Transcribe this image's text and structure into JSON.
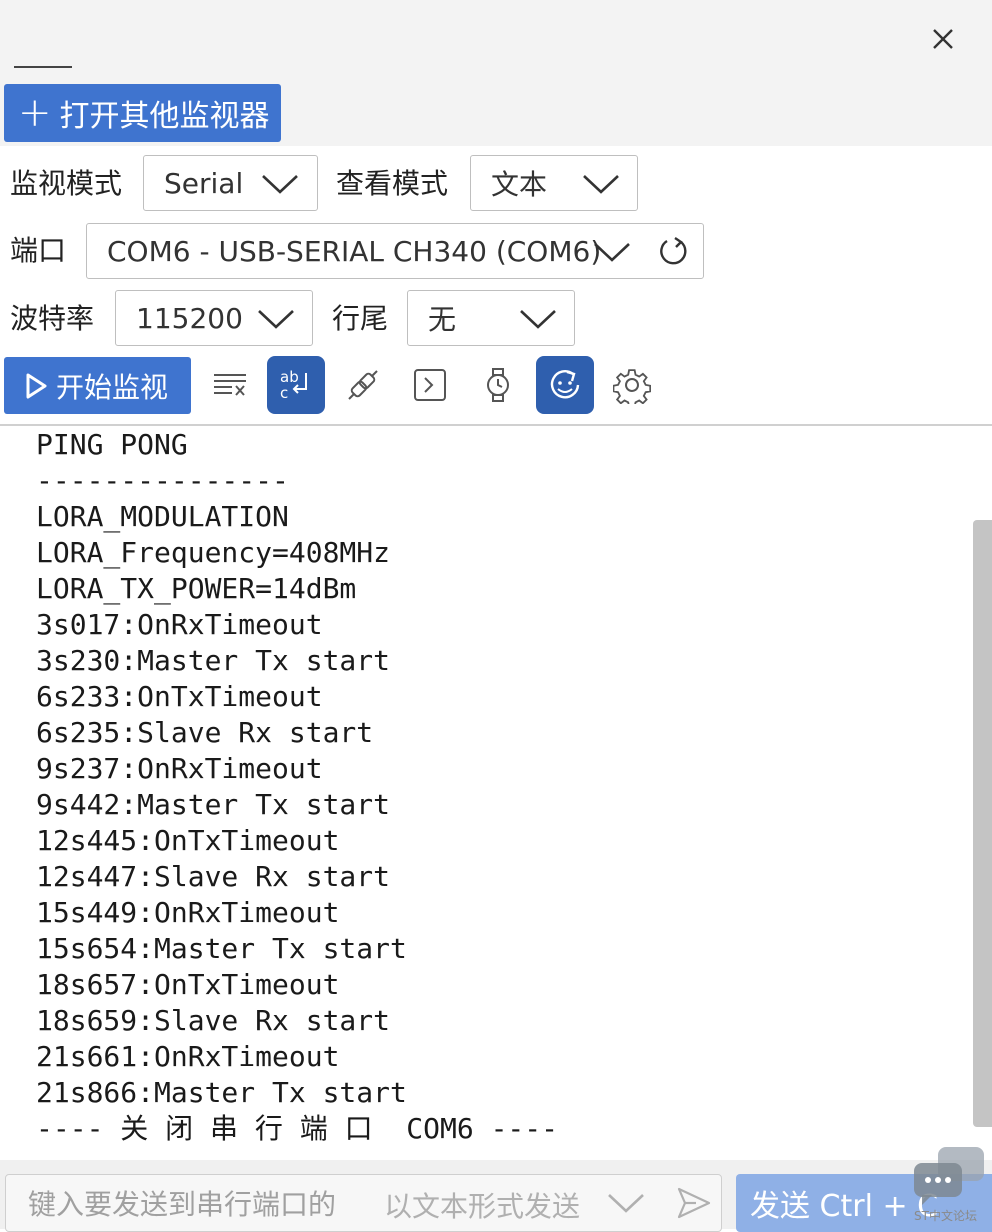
{
  "header": {
    "open_monitor_label": "打开其他监视器"
  },
  "settings": {
    "monitor_mode_label": "监视模式",
    "monitor_mode_value": "Serial",
    "view_mode_label": "查看模式",
    "view_mode_value": "文本",
    "port_label": "端口",
    "port_value": "COM6 - USB-SERIAL CH340 (COM6)",
    "baud_label": "波特率",
    "baud_value": "115200",
    "line_ending_label": "行尾",
    "line_ending_value": "无"
  },
  "toolbar": {
    "start_label": "开始监视",
    "icons": [
      "clear-icon",
      "text-wrap-icon",
      "connect-icon",
      "terminal-icon",
      "timestamp-icon",
      "auto-reconnect-icon",
      "settings-icon"
    ]
  },
  "console": {
    "lines": [
      "PING PONG",
      "---------------",
      "LORA_MODULATION",
      "LORA_Frequency=408MHz",
      "LORA_TX_POWER=14dBm",
      "3s017:OnRxTimeout",
      "3s230:Master Tx start",
      "6s233:OnTxTimeout",
      "6s235:Slave Rx start",
      "9s237:OnRxTimeout",
      "9s442:Master Tx start",
      "12s445:OnTxTimeout",
      "12s447:Slave Rx start",
      "15s449:OnRxTimeout",
      "15s654:Master Tx start",
      "18s657:OnTxTimeout",
      "18s659:Slave Rx start",
      "21s661:OnRxTimeout",
      "21s866:Master Tx start",
      "---- 关 闭 串 行 端 口  COM6 ----"
    ]
  },
  "send": {
    "placeholder": "键入要发送到串行端口的",
    "mode_label": "以文本形式发送",
    "button_label": "发送 Ctrl + C"
  },
  "watermark": {
    "text": "ST中文论坛"
  },
  "colors": {
    "accent": "#3f74cf",
    "accent_dark": "#2f5fae",
    "send_button": "#8fb0e6"
  }
}
